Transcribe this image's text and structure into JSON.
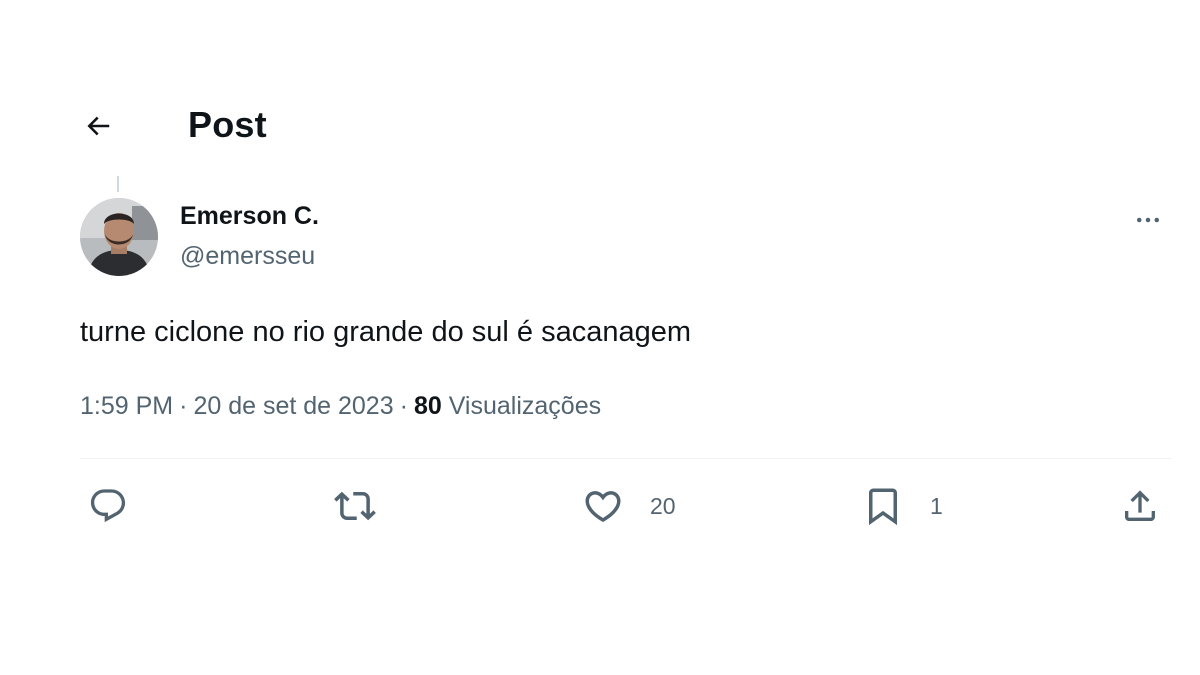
{
  "header": {
    "title": "Post",
    "back_icon": "arrow-left-icon"
  },
  "post": {
    "author": {
      "display_name": "Emerson C.",
      "handle": "@emersseu",
      "avatar_icon": "user-avatar"
    },
    "text": "turne ciclone no rio grande do sul é sacanagem",
    "time": "1:59 PM",
    "separator": "·",
    "date": "20 de set de 2023",
    "views_count": "80",
    "views_label": "Visualizações"
  },
  "actions": {
    "reply": {
      "icon": "reply-icon",
      "count": ""
    },
    "repost": {
      "icon": "repost-icon",
      "count": ""
    },
    "like": {
      "icon": "heart-icon",
      "count": "20"
    },
    "bookmark": {
      "icon": "bookmark-icon",
      "count": "1"
    },
    "share": {
      "icon": "share-icon"
    }
  },
  "colors": {
    "text_primary": "#0f1419",
    "text_secondary": "#536471",
    "divider": "#eff3f4"
  }
}
